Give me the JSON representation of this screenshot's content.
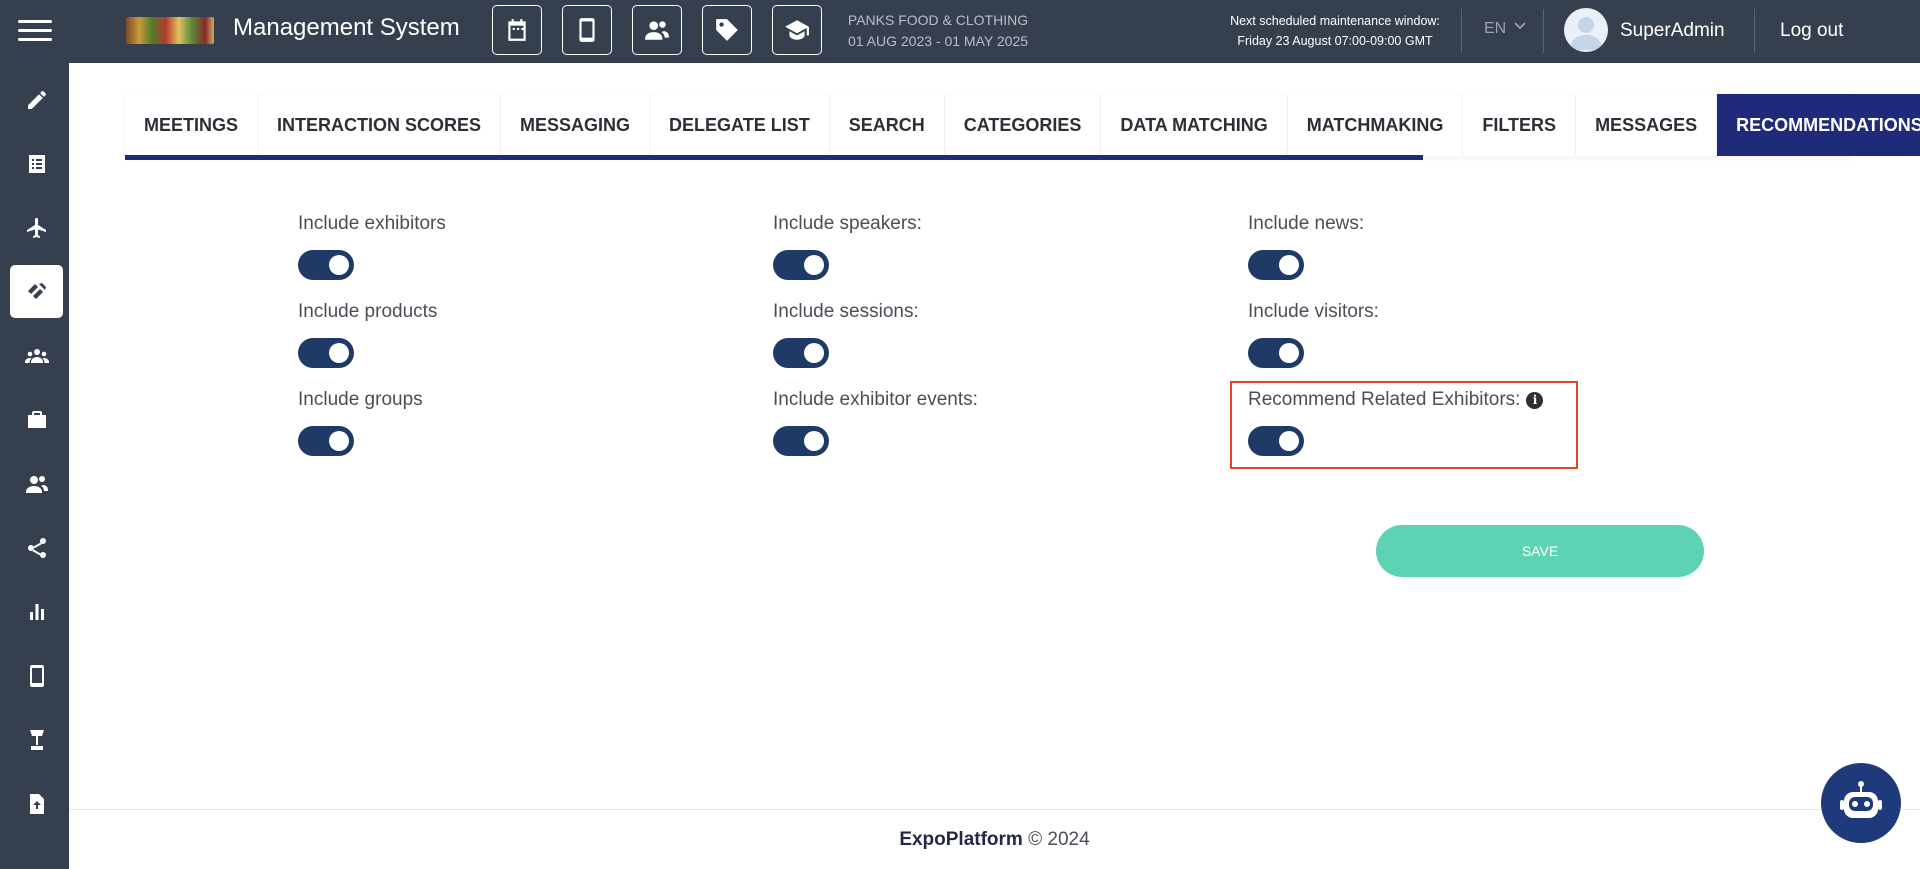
{
  "header": {
    "app_title": "Management System",
    "event_name": "PANKS FOOD & CLOTHING",
    "event_dates": "01 AUG 2023 - 01 MAY 2025",
    "maintenance_title": "Next scheduled maintenance window:",
    "maintenance_time": "Friday 23 August 07:00-09:00 GMT",
    "language": "EN",
    "user_name": "SuperAdmin",
    "logout_label": "Log out",
    "icons": [
      "calendar-icon",
      "mobile-icon",
      "users-icon",
      "tag-icon",
      "graduation-cap-icon"
    ]
  },
  "sidebar": {
    "items": [
      "pencil-icon",
      "list-icon",
      "plane-icon",
      "handshake-icon",
      "group-icon",
      "briefcase-icon",
      "user-friends-icon",
      "share-icon",
      "bar-chart-icon",
      "mobile-icon",
      "lamp-icon",
      "file-upload-icon"
    ],
    "active_index": 3
  },
  "tabs": [
    {
      "label": "MEETINGS"
    },
    {
      "label": "INTERACTION SCORES"
    },
    {
      "label": "MESSAGING"
    },
    {
      "label": "DELEGATE LIST"
    },
    {
      "label": "SEARCH"
    },
    {
      "label": "CATEGORIES"
    },
    {
      "label": "DATA MATCHING"
    },
    {
      "label": "MATCHMAKING"
    },
    {
      "label": "FILTERS"
    },
    {
      "label": "MESSAGES"
    },
    {
      "label": "RECOMMENDATIONS"
    }
  ],
  "active_tab": "RECOMMENDATIONS",
  "options": [
    {
      "label": "Include exhibitors",
      "enabled": true
    },
    {
      "label": "Include speakers:",
      "enabled": true
    },
    {
      "label": "Include news:",
      "enabled": true
    },
    {
      "label": "Include products",
      "enabled": true
    },
    {
      "label": "Include sessions:",
      "enabled": true
    },
    {
      "label": "Include visitors:",
      "enabled": true
    },
    {
      "label": "Include groups",
      "enabled": true
    },
    {
      "label": "Include exhibitor events:",
      "enabled": true
    },
    {
      "label": "Recommend Related Exhibitors:",
      "enabled": true
    }
  ],
  "save_label": "SAVE",
  "footer": {
    "brand": "ExpoPlatform",
    "copyright": "© 2024"
  },
  "colors": {
    "topbar": "#363f4d",
    "accent": "#1f2b7a",
    "toggle_on": "#1f3a66",
    "save_button": "#5dd3b3",
    "highlight": "#e0442c"
  }
}
